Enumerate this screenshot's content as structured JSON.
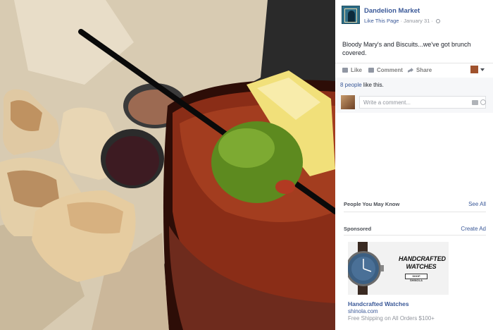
{
  "post": {
    "page_name": "Dandelion Market",
    "like_page_label": "Like This Page",
    "separator": "·",
    "date": "January 31",
    "text": "Bloody Mary's and Biscuits...we've got brunch covered."
  },
  "actions": {
    "like": "Like",
    "comment": "Comment",
    "share": "Share"
  },
  "feedback": {
    "likes_count": "8 people",
    "likes_suffix": " like this.",
    "comment_placeholder": "Write a comment..."
  },
  "people_you_may_know": {
    "title": "People You May Know",
    "see_all": "See All"
  },
  "sponsored": {
    "title": "Sponsored",
    "create_ad": "Create Ad",
    "ad": {
      "headline": "HANDCRAFTED WATCHES",
      "shop_button": "SHOP SHINOLA",
      "title": "Handcrafted Watches",
      "domain": "shinola.com",
      "description": "Free Shipping on All Orders $100+"
    }
  },
  "icons": {
    "like": "thumbs-up-icon",
    "comment": "comment-bubble-icon",
    "share": "share-arrow-icon",
    "globe": "globe-icon",
    "camera": "camera-icon",
    "emoji": "smile-icon"
  },
  "colors": {
    "link": "#3b5998",
    "muted": "#90949c",
    "text": "#1d2129",
    "feedback_bg": "#f6f7f9"
  }
}
